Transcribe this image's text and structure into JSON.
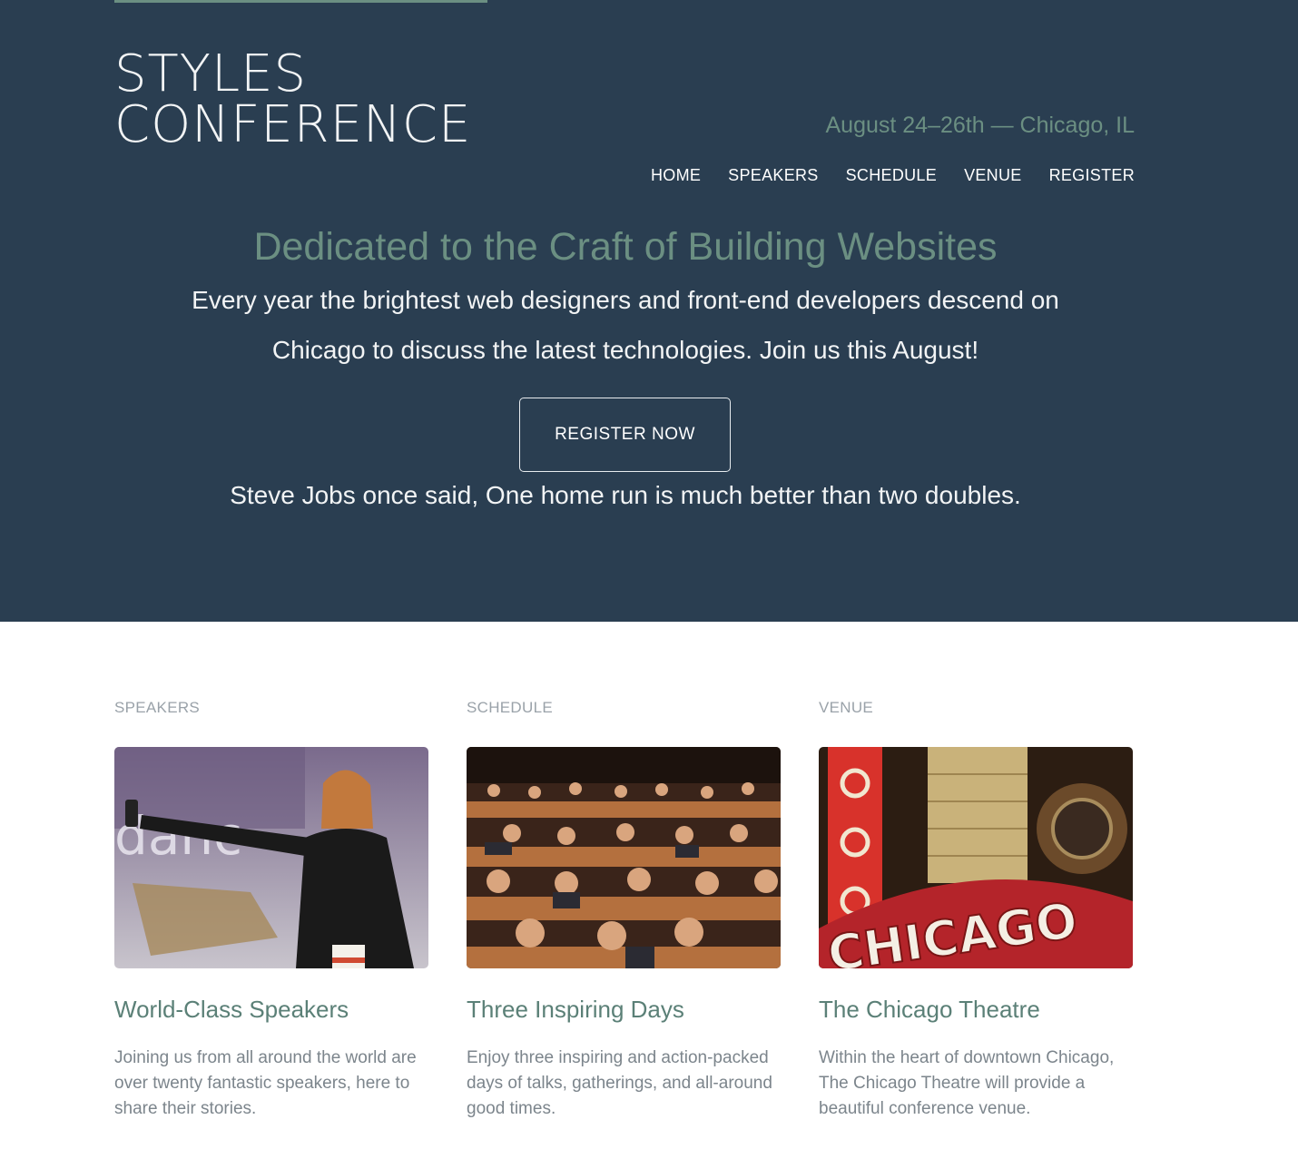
{
  "header": {
    "logo_line1": "STYLES",
    "logo_line2": "CONFERENCE",
    "event_date": "August 24–26th — Chicago, IL",
    "nav": [
      "HOME",
      "SPEAKERS",
      "SCHEDULE",
      "VENUE",
      "REGISTER"
    ]
  },
  "hero": {
    "tagline": "Dedicated to the Craft of Building Websites",
    "intro": "Every year the brightest web designers and front-end developers descend on Chicago to discuss the latest technologies. Join us this August!",
    "cta_label": "REGISTER NOW",
    "quote": "Steve Jobs once said, One home run is much better than two doubles."
  },
  "sections": [
    {
      "label": "SPEAKERS",
      "title": "World-Class Speakers",
      "text": "Joining us from all around the world are over twenty fantastic speakers, here to share their stories."
    },
    {
      "label": "SCHEDULE",
      "title": "Three Inspiring Days",
      "text": "Enjoy three inspiring and action-packed days of talks, gatherings, and all-around good times."
    },
    {
      "label": "VENUE",
      "title": "The Chicago Theatre",
      "text": "Within the heart of downtown Chicago, The Chicago Theatre will provide a beautiful conference venue."
    }
  ],
  "colors": {
    "hero_bg": "#2a3e51",
    "accent_green": "#6b8f82",
    "title_green": "#5b8077",
    "label_gray": "#9aa2a9",
    "body_gray": "#7c858c"
  }
}
